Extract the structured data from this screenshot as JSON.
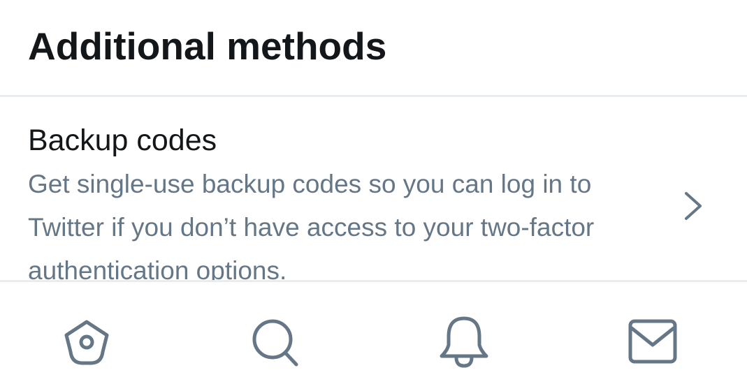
{
  "section": {
    "title": "Additional methods"
  },
  "methods": [
    {
      "title": "Backup codes",
      "description": "Get single-use backup codes so you can log in to Twitter if you don’t have access to your two-factor authentication options.",
      "icon": "chevron-right-icon"
    }
  ],
  "tab_bar": {
    "tabs": [
      {
        "name": "home",
        "icon": "home-icon"
      },
      {
        "name": "search",
        "icon": "search-icon"
      },
      {
        "name": "notifications",
        "icon": "bell-icon"
      },
      {
        "name": "messages",
        "icon": "mail-icon"
      }
    ],
    "icon_color": "#657786"
  },
  "colors": {
    "title": "#14171a",
    "secondary_text": "#657786",
    "divider": "#e6ecf0",
    "background": "#ffffff"
  }
}
